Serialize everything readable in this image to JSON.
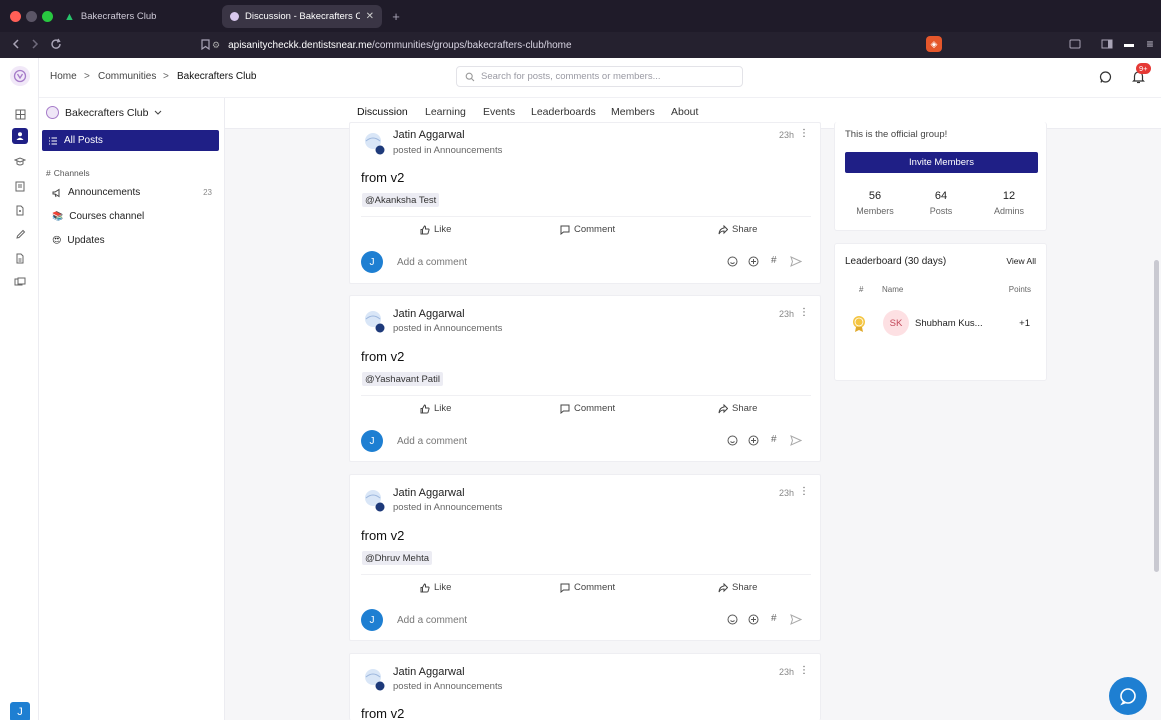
{
  "browser": {
    "tabs": [
      {
        "title": "Bakecrafters Club"
      },
      {
        "title": "Discussion - Bakecrafters Club"
      }
    ],
    "url_host": "apisanitycheckk.dentistsnear.me",
    "url_path": "/communities/groups/bakecrafters-club/home",
    "extension_badge": "",
    "new_tab": "+"
  },
  "app": {
    "breadcrumb": [
      "Home",
      ">",
      "Communities",
      ">",
      "Bakecrafters Club"
    ],
    "search_placeholder": "Search for posts, comments or members...",
    "notif_badge": "9+",
    "user_initial": "J"
  },
  "sidebar": {
    "group_name": "Bakecrafters Club",
    "all_posts": "All Posts",
    "channels_heading": "Channels",
    "channels": [
      {
        "label": "Announcements",
        "count": "23"
      },
      {
        "label": "Courses channel",
        "count": ""
      },
      {
        "label": "Updates",
        "count": ""
      }
    ]
  },
  "tabs": [
    "Discussion",
    "Learning",
    "Events",
    "Leaderboards",
    "Members",
    "About"
  ],
  "posts": [
    {
      "author": "Jatin Aggarwal",
      "subtitle": "posted in Announcements",
      "time": "23h",
      "title": "from v2",
      "mention": "@Akanksha Test"
    },
    {
      "author": "Jatin Aggarwal",
      "subtitle": "posted in Announcements",
      "time": "23h",
      "title": "from v2",
      "mention": "@Yashavant Patil"
    },
    {
      "author": "Jatin Aggarwal",
      "subtitle": "posted in Announcements",
      "time": "23h",
      "title": "from v2",
      "mention": "@Dhruv Mehta"
    },
    {
      "author": "Jatin Aggarwal",
      "subtitle": "posted in Announcements",
      "time": "23h",
      "title": "from v2",
      "mention": ""
    }
  ],
  "post_actions": {
    "like": "Like",
    "comment": "Comment",
    "share": "Share",
    "add_comment": "Add a comment",
    "hash": "#"
  },
  "group_card": {
    "description": "This is the official group!",
    "invite_label": "Invite Members",
    "stats": [
      {
        "value": "56",
        "label": "Members"
      },
      {
        "value": "64",
        "label": "Posts"
      },
      {
        "value": "12",
        "label": "Admins"
      }
    ]
  },
  "leaderboard": {
    "title": "Leaderboard (30 days)",
    "view_all": "View All",
    "col_rank": "#",
    "col_name": "Name",
    "col_points": "Points",
    "rows": [
      {
        "initials": "SK",
        "name": "Shubham Kus...",
        "points": "+1"
      }
    ]
  },
  "colors": {
    "primary": "#1f1f86",
    "accent": "#e53935",
    "chat": "#1e7fd2"
  }
}
